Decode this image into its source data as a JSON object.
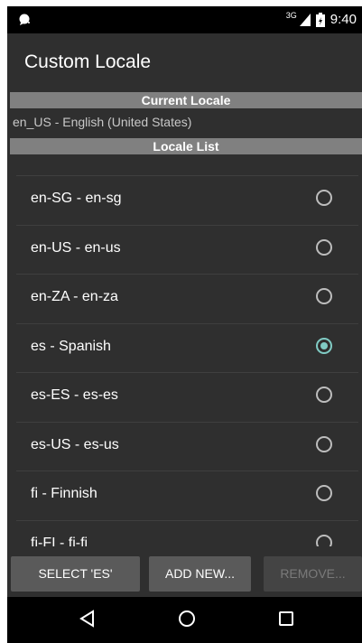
{
  "status_bar": {
    "network": "3G",
    "time": "9:40",
    "icons": [
      "notification-icon",
      "signal-icon",
      "battery-icon"
    ]
  },
  "app_bar": {
    "title": "Custom Locale"
  },
  "current_locale": {
    "header": "Current Locale",
    "value": "en_US - English (United States)"
  },
  "locale_list": {
    "header": "Locale List",
    "items": [
      {
        "label": "en-SG - en-sg",
        "selected": false
      },
      {
        "label": "en-US - en-us",
        "selected": false
      },
      {
        "label": "en-ZA - en-za",
        "selected": false
      },
      {
        "label": "es - Spanish",
        "selected": true
      },
      {
        "label": "es-ES - es-es",
        "selected": false
      },
      {
        "label": "es-US - es-us",
        "selected": false
      },
      {
        "label": "fi - Finnish",
        "selected": false
      },
      {
        "label": "fi-FI - fi-fi",
        "selected": false
      }
    ]
  },
  "buttons": {
    "select": "SELECT 'ES'",
    "add_new": "ADD NEW...",
    "remove": "REMOVE..."
  },
  "nav_bar": {
    "icons": [
      "back-icon",
      "home-icon",
      "recents-icon"
    ]
  },
  "colors": {
    "background": "#2f2f2f",
    "section_header": "#808080",
    "accent": "#80cbc4",
    "button": "#5a5a5a"
  }
}
